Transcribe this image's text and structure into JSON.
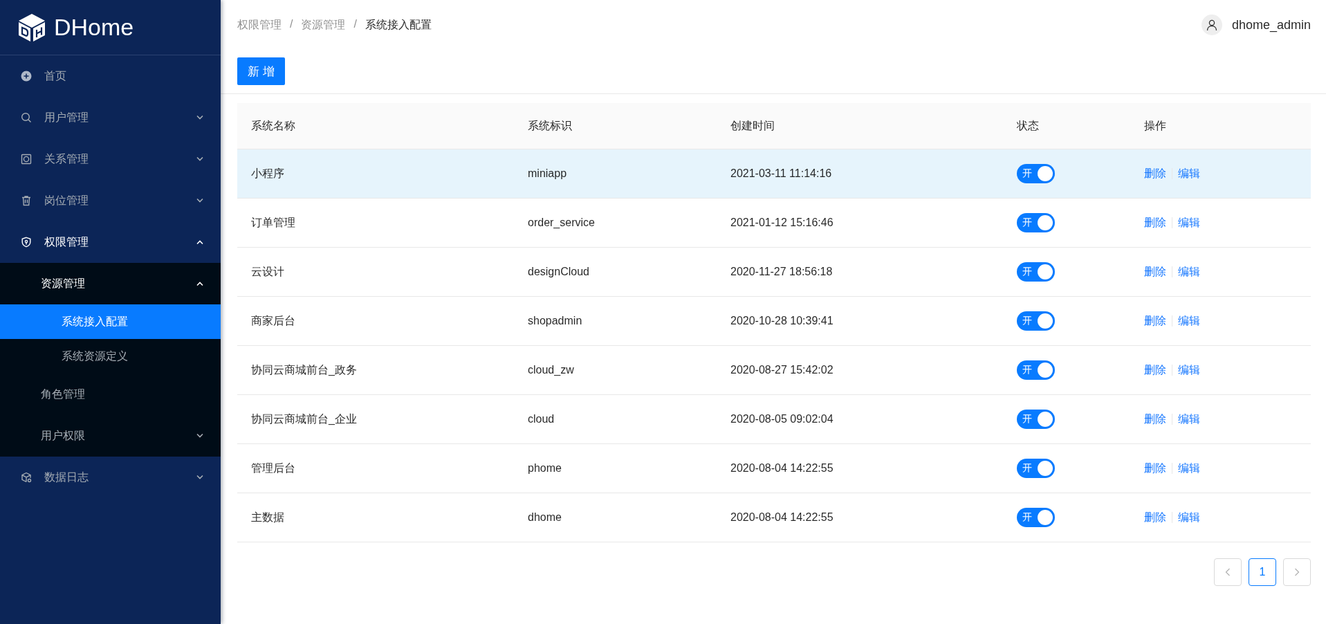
{
  "sidebar": {
    "logo": "DHome",
    "items": [
      {
        "label": "首页",
        "selected": false
      },
      {
        "label": "用户管理",
        "expanded": false,
        "selected": false
      },
      {
        "label": "关系管理",
        "expanded": false,
        "selected": false
      },
      {
        "label": "岗位管理",
        "expanded": false,
        "selected": false
      },
      {
        "label": "权限管理",
        "expanded": true,
        "selected": false,
        "children": [
          {
            "label": "资源管理",
            "expanded": true,
            "selected": false,
            "children": [
              {
                "label": "系统接入配置",
                "selected": true
              },
              {
                "label": "系统资源定义",
                "selected": false
              }
            ]
          },
          {
            "label": "角色管理",
            "selected": false
          },
          {
            "label": "用户权限",
            "expanded": false,
            "selected": false
          }
        ]
      },
      {
        "label": "数据日志",
        "expanded": false,
        "selected": false
      }
    ]
  },
  "breadcrumb": {
    "items": [
      "权限管理",
      "资源管理",
      "系统接入配置"
    ],
    "separators": [
      "/",
      "/"
    ]
  },
  "user": {
    "name": "dhome_admin"
  },
  "toolbar": {
    "add_button": "新 增"
  },
  "table": {
    "columns": [
      "系统名称",
      "系统标识",
      "创建时间",
      "状态",
      "操作"
    ],
    "rows": [
      {
        "name": "小程序",
        "code": "miniapp",
        "created": "2021-03-11 11:14:16",
        "status": {
          "label": "开",
          "on": true
        },
        "actions": [
          "删除",
          "编辑"
        ],
        "selected": true
      },
      {
        "name": "订单管理",
        "code": "order_service",
        "created": "2021-01-12 15:16:46",
        "status": {
          "label": "开",
          "on": true
        },
        "actions": [
          "删除",
          "编辑"
        ],
        "selected": false
      },
      {
        "name": "云设计",
        "code": "designCloud",
        "created": "2020-11-27 18:56:18",
        "status": {
          "label": "开",
          "on": true
        },
        "actions": [
          "删除",
          "编辑"
        ],
        "selected": false
      },
      {
        "name": "商家后台",
        "code": "shopadmin",
        "created": "2020-10-28 10:39:41",
        "status": {
          "label": "开",
          "on": true
        },
        "actions": [
          "删除",
          "编辑"
        ],
        "selected": false
      },
      {
        "name": "协同云商城前台_政务",
        "code": "cloud_zw",
        "created": "2020-08-27 15:42:02",
        "status": {
          "label": "开",
          "on": true
        },
        "actions": [
          "删除",
          "编辑"
        ],
        "selected": false
      },
      {
        "name": "协同云商城前台_企业",
        "code": "cloud",
        "created": "2020-08-05 09:02:04",
        "status": {
          "label": "开",
          "on": true
        },
        "actions": [
          "删除",
          "编辑"
        ],
        "selected": false
      },
      {
        "name": "管理后台",
        "code": "phome",
        "created": "2020-08-04 14:22:55",
        "status": {
          "label": "开",
          "on": true
        },
        "actions": [
          "删除",
          "编辑"
        ],
        "selected": false
      },
      {
        "name": "主数据",
        "code": "dhome",
        "created": "2020-08-04 14:22:55",
        "status": {
          "label": "开",
          "on": true
        },
        "actions": [
          "删除",
          "编辑"
        ],
        "selected": false
      }
    ]
  },
  "pagination": {
    "pages": [
      {
        "label": "1",
        "selected": true
      }
    ]
  }
}
